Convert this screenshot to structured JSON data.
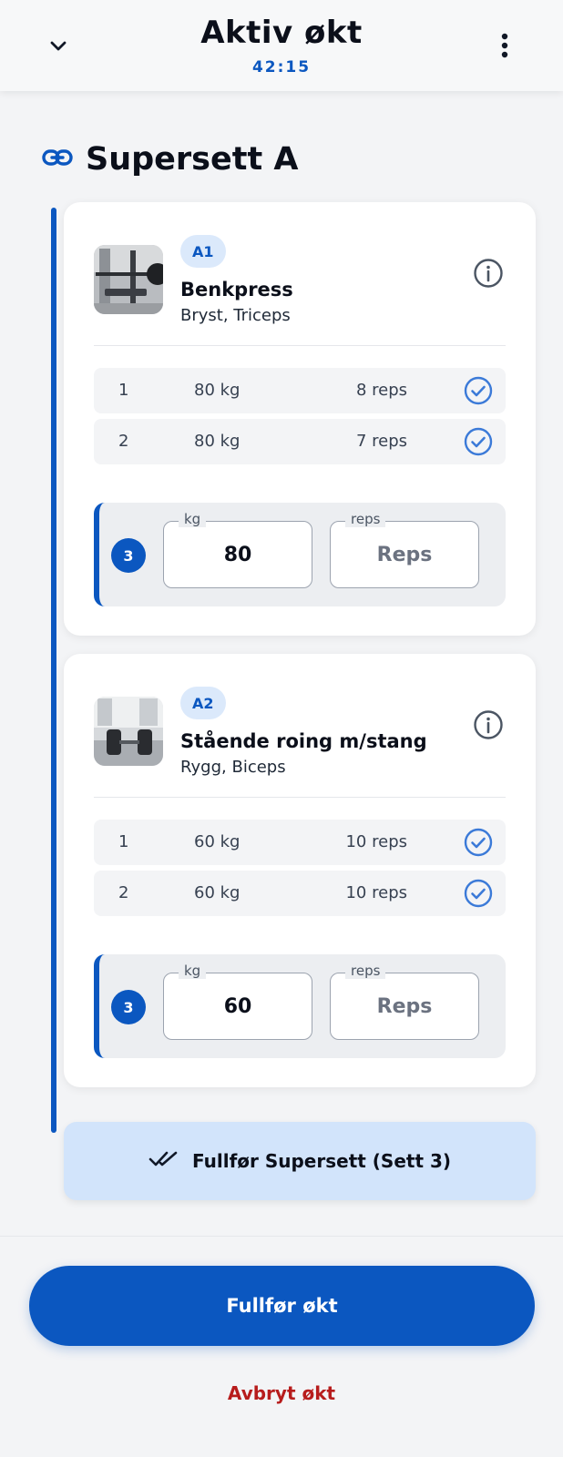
{
  "header": {
    "title": "Aktiv økt",
    "timer": "42:15",
    "collapse_icon": "chevron-down-icon",
    "menu_icon": "more-vertical-icon"
  },
  "superset": {
    "icon": "link-icon",
    "title": "Supersett A",
    "accent_color": "#0b57c0"
  },
  "exercises": [
    {
      "badge": "A1",
      "name": "Benkpress",
      "muscles": "Bryst, Triceps",
      "image": "bench-press-photo",
      "completed_sets": [
        {
          "set": "1",
          "weight": "80 kg",
          "reps": "8 reps"
        },
        {
          "set": "2",
          "weight": "80 kg",
          "reps": "7 reps"
        }
      ],
      "active_set": {
        "set": "3",
        "kg_label": "kg",
        "kg_value": "80",
        "reps_label": "reps",
        "reps_placeholder": "Reps"
      }
    },
    {
      "badge": "A2",
      "name": "Stående roing m/stang",
      "muscles": "Rygg, Biceps",
      "image": "barbell-row-photo",
      "completed_sets": [
        {
          "set": "1",
          "weight": "60 kg",
          "reps": "10 reps"
        },
        {
          "set": "2",
          "weight": "60 kg",
          "reps": "10 reps"
        }
      ],
      "active_set": {
        "set": "3",
        "kg_label": "kg",
        "kg_value": "60",
        "reps_label": "reps",
        "reps_placeholder": "Reps"
      }
    }
  ],
  "complete_superset": {
    "icon": "double-check-icon",
    "label": "Fullfør Supersett (Sett 3)"
  },
  "footer": {
    "finish_label": "Fullfør økt",
    "cancel_label": "Avbryt økt",
    "cancel_color": "#b71c1c"
  }
}
